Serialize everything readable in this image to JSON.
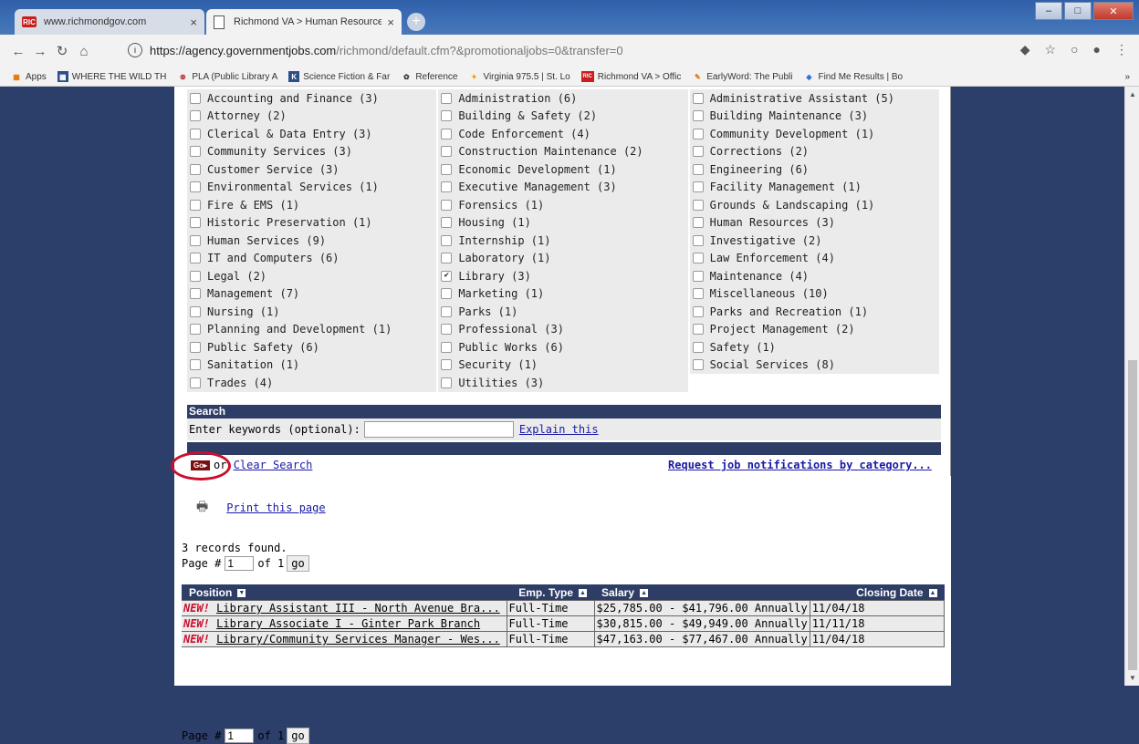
{
  "browser": {
    "tabs": [
      {
        "label": "www.richmondgov.com",
        "favicon": "RIC",
        "active": false
      },
      {
        "label": "Richmond VA > Human Resource",
        "favicon": "document-icon",
        "active": true
      }
    ],
    "url_host": "https://agency.governmentjobs.com",
    "url_path": "/richmond/default.cfm?&promotionaljobs=0&transfer=0",
    "bookmarks": [
      {
        "label": "Apps",
        "icon": "apps-grid-icon"
      },
      {
        "label": "WHERE THE WILD TH",
        "icon": "grid-icon"
      },
      {
        "label": "PLA (Public Library A",
        "icon": "pla-icon"
      },
      {
        "label": "Science Fiction & Far",
        "icon": "k-icon"
      },
      {
        "label": "Reference",
        "icon": "reference-icon"
      },
      {
        "label": "Virginia 975.5 | St. Lo",
        "icon": "star-icon"
      },
      {
        "label": "Richmond VA > Offic",
        "icon": "ric-icon"
      },
      {
        "label": "EarlyWord: The Publi",
        "icon": "earlyword-icon"
      },
      {
        "label": "Find Me Results | Bo",
        "icon": "diamond-icon"
      }
    ],
    "more": "»"
  },
  "categories": [
    [
      {
        "label": "Accounting and Finance (3)",
        "checked": false
      },
      {
        "label": "Administration (6)",
        "checked": false
      },
      {
        "label": "Administrative Assistant (5)",
        "checked": false
      }
    ],
    [
      {
        "label": "Attorney (2)",
        "checked": false
      },
      {
        "label": "Building & Safety (2)",
        "checked": false
      },
      {
        "label": "Building Maintenance (3)",
        "checked": false
      }
    ],
    [
      {
        "label": "Clerical & Data Entry (3)",
        "checked": false
      },
      {
        "label": "Code Enforcement (4)",
        "checked": false
      },
      {
        "label": "Community Development (1)",
        "checked": false
      }
    ],
    [
      {
        "label": "Community Services (3)",
        "checked": false
      },
      {
        "label": "Construction Maintenance (2)",
        "checked": false
      },
      {
        "label": "Corrections (2)",
        "checked": false
      }
    ],
    [
      {
        "label": "Customer Service (3)",
        "checked": false
      },
      {
        "label": "Economic Development (1)",
        "checked": false
      },
      {
        "label": "Engineering (6)",
        "checked": false
      }
    ],
    [
      {
        "label": "Environmental Services (1)",
        "checked": false
      },
      {
        "label": "Executive Management (3)",
        "checked": false
      },
      {
        "label": "Facility Management (1)",
        "checked": false
      }
    ],
    [
      {
        "label": "Fire & EMS (1)",
        "checked": false
      },
      {
        "label": "Forensics (1)",
        "checked": false
      },
      {
        "label": "Grounds & Landscaping (1)",
        "checked": false
      }
    ],
    [
      {
        "label": "Historic Preservation (1)",
        "checked": false
      },
      {
        "label": "Housing (1)",
        "checked": false
      },
      {
        "label": "Human Resources (3)",
        "checked": false
      }
    ],
    [
      {
        "label": "Human Services (9)",
        "checked": false
      },
      {
        "label": "Internship (1)",
        "checked": false
      },
      {
        "label": "Investigative (2)",
        "checked": false
      }
    ],
    [
      {
        "label": "IT and Computers (6)",
        "checked": false
      },
      {
        "label": "Laboratory (1)",
        "checked": false
      },
      {
        "label": "Law Enforcement (4)",
        "checked": false
      }
    ],
    [
      {
        "label": "Legal (2)",
        "checked": false
      },
      {
        "label": "Library (3)",
        "checked": true
      },
      {
        "label": "Maintenance (4)",
        "checked": false
      }
    ],
    [
      {
        "label": "Management (7)",
        "checked": false
      },
      {
        "label": "Marketing (1)",
        "checked": false
      },
      {
        "label": "Miscellaneous (10)",
        "checked": false
      }
    ],
    [
      {
        "label": "Nursing (1)",
        "checked": false
      },
      {
        "label": "Parks (1)",
        "checked": false
      },
      {
        "label": "Parks and Recreation (1)",
        "checked": false
      }
    ],
    [
      {
        "label": "Planning and Development (1)",
        "checked": false
      },
      {
        "label": "Professional (3)",
        "checked": false
      },
      {
        "label": "Project Management (2)",
        "checked": false
      }
    ],
    [
      {
        "label": "Public Safety (6)",
        "checked": false
      },
      {
        "label": "Public Works (6)",
        "checked": false
      },
      {
        "label": "Safety (1)",
        "checked": false
      }
    ],
    [
      {
        "label": "Sanitation (1)",
        "checked": false
      },
      {
        "label": "Security (1)",
        "checked": false
      },
      {
        "label": "Social Services (8)",
        "checked": false
      }
    ],
    [
      {
        "label": "Trades (4)",
        "checked": false
      },
      {
        "label": "Utilities (3)",
        "checked": false
      },
      null
    ]
  ],
  "search": {
    "header": "Search",
    "label": "Enter keywords (optional):",
    "value": "",
    "explain": "Explain this",
    "go": "Go",
    "or": "or",
    "clear": "Clear Search",
    "notify": "Request job notifications by category..."
  },
  "print": {
    "label": "Print this page"
  },
  "records": {
    "found": "3 records found.",
    "page_label": "Page #",
    "page_value": "1",
    "of": "of 1",
    "go": "go"
  },
  "table": {
    "headers": [
      "Position",
      "Emp. Type",
      "Salary",
      "Closing Date"
    ],
    "rows": [
      {
        "new": "NEW!",
        "position": "Library Assistant III - North Avenue Bra...",
        "type": "Full-Time",
        "salary": "$25,785.00 - $41,796.00 Annually",
        "closing": "11/04/18"
      },
      {
        "new": "NEW!",
        "position": "Library Associate I - Ginter Park Branch",
        "type": "Full-Time",
        "salary": "$30,815.00 - $49,949.00 Annually",
        "closing": "11/11/18"
      },
      {
        "new": "NEW!",
        "position": "Library/Community Services Manager - Wes...",
        "type": "Full-Time",
        "salary": "$47,163.00 - $77,467.00 Annually",
        "closing": "11/04/18"
      }
    ]
  },
  "colors": {
    "header_navy": "#2e3d66",
    "new_red": "#c8102e",
    "link_blue": "#1a1aa6"
  }
}
